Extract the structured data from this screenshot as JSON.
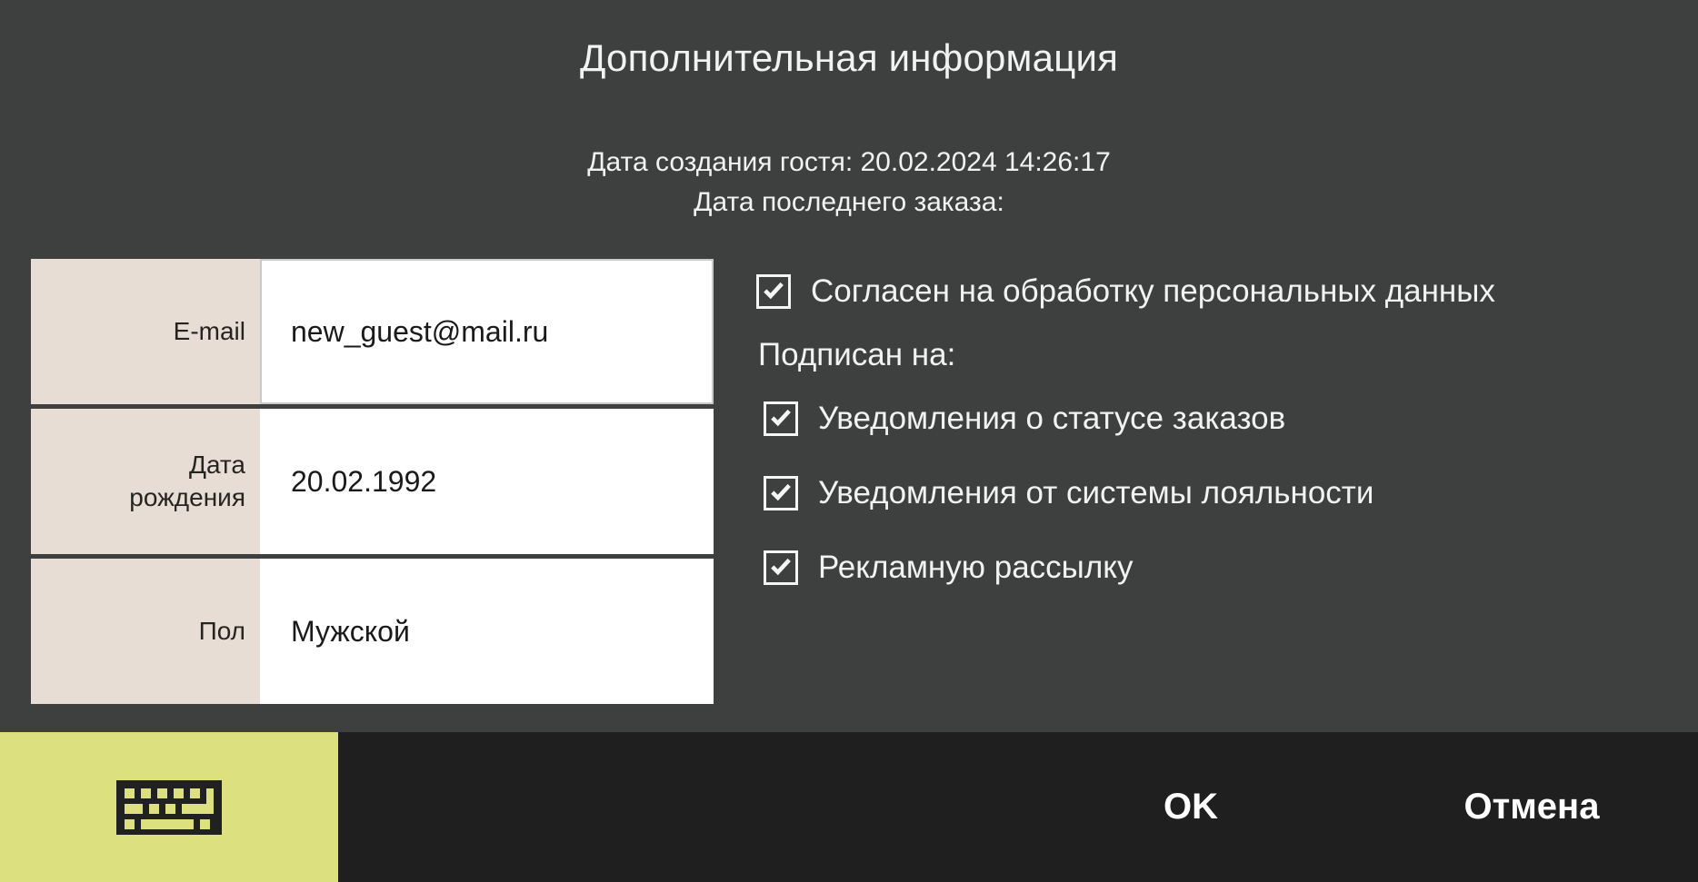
{
  "dialog": {
    "title": "Дополнительная информация",
    "meta": [
      "Дата создания гостя: 20.02.2024 14:26:17",
      "Дата последнего заказа:"
    ]
  },
  "form": {
    "rows": [
      {
        "label": "E-mail",
        "value": "new_guest@mail.ru",
        "focused": true
      },
      {
        "label": "Дата\nрождения",
        "value": "20.02.1992",
        "focused": false
      },
      {
        "label": "Пол",
        "value": "Мужской",
        "focused": false
      }
    ]
  },
  "consent": {
    "personal_data": {
      "label": "Согласен на обработку персональных данных",
      "checked": true
    },
    "subscribe_heading": "Подписан на:",
    "subscriptions": [
      {
        "label": "Уведомления о статусе заказов",
        "checked": true
      },
      {
        "label": "Уведомления от системы лояльности",
        "checked": true
      },
      {
        "label": "Рекламную рассылку",
        "checked": true
      }
    ]
  },
  "bottom_bar": {
    "keyboard_icon": "keyboard-icon",
    "ok_label": "OK",
    "cancel_label": "Отмена"
  },
  "colors": {
    "background": "#3e4040",
    "label_cell": "#e7ddd4",
    "value_cell": "#ffffff",
    "bottom_bar": "#1f1f1f",
    "keyboard_panel": "#dde07f",
    "text": "#f2f2f2"
  }
}
